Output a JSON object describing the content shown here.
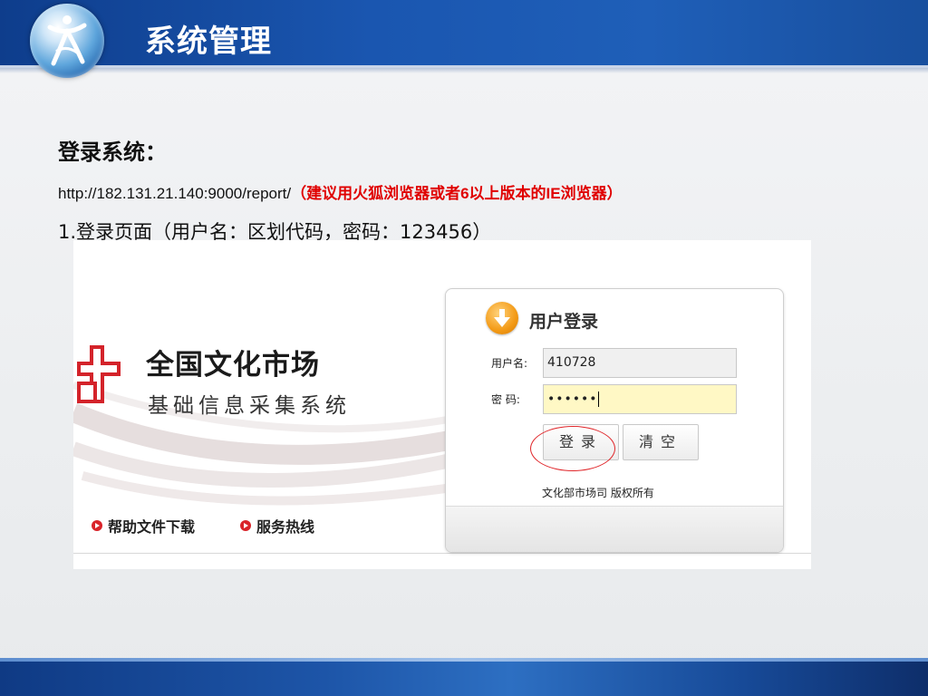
{
  "slide": {
    "title": "系统管理",
    "heading": "登录系统：",
    "url": "http://182.131.21.140:9000/report/",
    "url_note": "（建议用火狐浏览器或者6以上版本的IE浏览器）",
    "step": "1.登录页面（用户名：区划代码，密码：123456）"
  },
  "screenshot": {
    "brand_title": "全国文化市场",
    "brand_subtitle": "基础信息采集系统",
    "links": [
      "帮助文件下载",
      "服务热线"
    ],
    "login": {
      "title": "用户登录",
      "username_label": "用户名:",
      "username_value": "410728",
      "password_label": "密 码:",
      "password_value": "••••••",
      "login_button": "登录",
      "clear_button": "清空",
      "copyright": "文化部市场司 版权所有"
    }
  },
  "colors": {
    "header_blue": "#1a56b0",
    "note_red": "#e00000",
    "brand_red": "#d9242a",
    "login_icon_orange": "#f39a16"
  },
  "icons": [
    "app-logo-icon",
    "brand-logo-icon",
    "download-arrow-icon",
    "bullet-arrow-icon"
  ]
}
